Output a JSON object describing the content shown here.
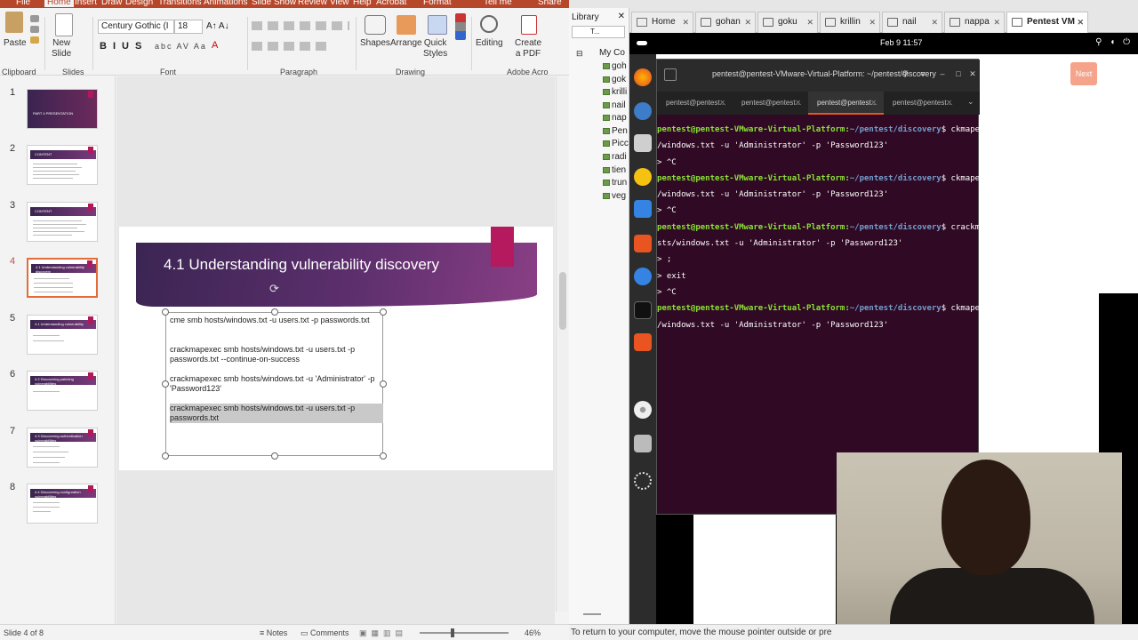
{
  "ppt": {
    "menu_tabs": [
      "File",
      "Home",
      "Insert",
      "Draw",
      "Design",
      "Transitions",
      "Animations",
      "Slide Show",
      "Review",
      "View",
      "Help",
      "Acrobat",
      "Format",
      "Tell me",
      "Share"
    ],
    "ribbon": {
      "paste": "Paste",
      "new_slide": "New\nSlide",
      "font_name": "Century Gothic (I",
      "font_size": "18",
      "shapes": "Shapes",
      "arrange": "Arrange",
      "quick_styles": "Quick\nStyles",
      "editing": "Editing",
      "create_pdf": "Create\na PDF",
      "groups": [
        "Clipboard",
        "Slides",
        "Font",
        "Paragraph",
        "Drawing",
        "Adobe Acro"
      ]
    },
    "thumbnails": [
      {
        "num": "1",
        "title": "PART 4 PRESENTATION"
      },
      {
        "num": "2",
        "title": "CONTENT"
      },
      {
        "num": "3",
        "title": "CONTENT"
      },
      {
        "num": "4",
        "title": "4.1 Understanding vulnerability discovery"
      },
      {
        "num": "5",
        "title": "4.1 Understanding vulnerability"
      },
      {
        "num": "6",
        "title": "4.2 Discovering patching vulnerabilities"
      },
      {
        "num": "7",
        "title": "4.3 Discovering authentication vulnerabilities"
      },
      {
        "num": "8",
        "title": "4.4 Discovering configuration vulnerabilities"
      }
    ],
    "slide": {
      "title": "4.1 Understanding vulnerability discovery",
      "lines": [
        "cme smb hosts/windows.txt -u users.txt -p passwords.txt",
        "crackmapexec smb hosts/windows.txt -u users.txt -p passwords.txt --continue-on-success",
        "crackmapexec smb hosts/windows.txt -u 'Administrator' -p 'Password123'",
        "crackmapexec smb hosts/windows.txt -u users.txt -p passwords.txt"
      ]
    },
    "status": {
      "slide_of": "Slide 4 of 8",
      "notes": "Notes",
      "comments": "Comments",
      "zoom": "46%"
    }
  },
  "vm": {
    "library": {
      "title": "Library",
      "search": "T...",
      "root": "My Co",
      "items": [
        "goh",
        "gok",
        "krilli",
        "nail",
        "nap",
        "Pen",
        "Picc",
        "radi",
        "tien",
        "trun",
        "veg"
      ]
    },
    "tabs": [
      {
        "label": "Home"
      },
      {
        "label": "gohan"
      },
      {
        "label": "goku"
      },
      {
        "label": "krillin"
      },
      {
        "label": "nail"
      },
      {
        "label": "nappa"
      },
      {
        "label": "Pentest VM"
      }
    ],
    "guest": {
      "clock": "Feb 9  11:57",
      "next_button": "Next",
      "terminal": {
        "title": "pentest@pentest-VMware-Virtual-Platform: ~/pentest/discovery",
        "tabs": [
          "pentest@pentest...",
          "pentest@pentest...",
          "pentest@pentest...",
          "pentest@pentest..."
        ],
        "prompt_user": "pentest@pentest-VMware-Virtual-Platform",
        "prompt_path": "~/pentest/discovery",
        "lines": [
          {
            "type": "prompt",
            "cmd": "$ ckmapexec smb hosts"
          },
          {
            "type": "out",
            "text": "/windows.txt -u 'Administrator' -p 'Password123'"
          },
          {
            "type": "out",
            "text": "> ^C"
          },
          {
            "type": "prompt",
            "cmd": "$ ckmapexec smb hosts"
          },
          {
            "type": "out",
            "text": "/windows.txt -u 'Administrator' -p 'Password123'"
          },
          {
            "type": "out",
            "text": "> ^C"
          },
          {
            "type": "prompt",
            "cmd": "$ crackmapexec smb ho"
          },
          {
            "type": "out",
            "text": "sts/windows.txt -u 'Administrator' -p 'Password123'"
          },
          {
            "type": "out",
            "text": "> ;"
          },
          {
            "type": "out",
            "text": "> exit"
          },
          {
            "type": "out",
            "text": "> ^C"
          },
          {
            "type": "prompt",
            "cmd": "$ ckmapexec smb hosts"
          },
          {
            "type": "out",
            "text": "/windows.txt -u 'Administrator' -p 'Password123'"
          }
        ]
      }
    },
    "status_text": "To return to your computer, move the mouse pointer outside or pre"
  },
  "colors": {
    "ppt_accent": "#b7472a",
    "slide_band": "#4a2a5e",
    "slide_tab": "#b5195e",
    "terminal_bg": "#300a24",
    "prompt_user": "#8ae234",
    "prompt_path": "#729fcf"
  }
}
